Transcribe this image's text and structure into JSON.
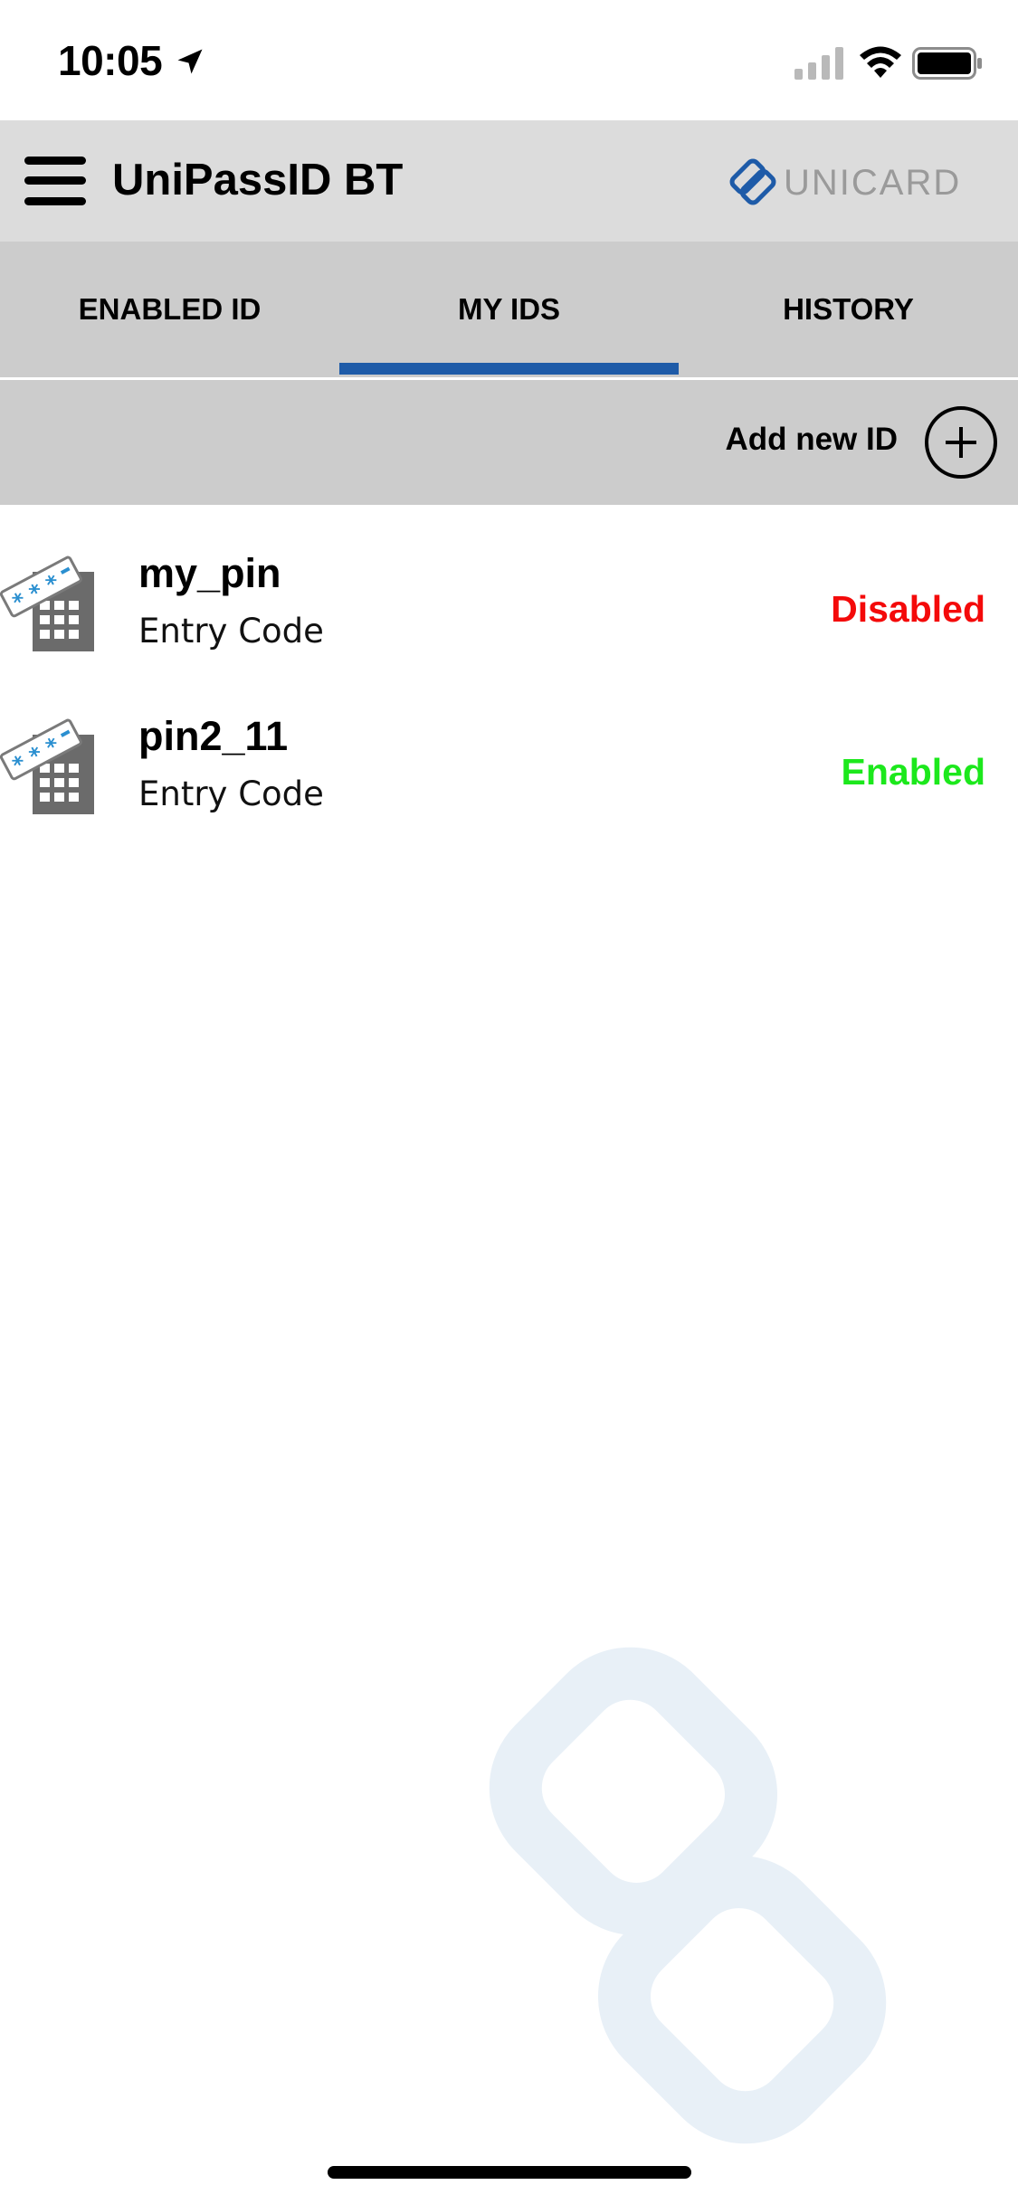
{
  "status_bar": {
    "time": "10:05",
    "location_icon": "location-arrow-icon",
    "signal_icon": "cellular-signal-icon",
    "wifi_icon": "wifi-icon",
    "battery_icon": "battery-icon"
  },
  "header": {
    "menu_icon": "hamburger-menu-icon",
    "title": "UniPassID BT",
    "brand_name": "UNICARD",
    "brand_color": "#1e5ba8"
  },
  "tabs": [
    {
      "label": "ENABLED ID",
      "active": false
    },
    {
      "label": "MY IDS",
      "active": true
    },
    {
      "label": "HISTORY",
      "active": false
    }
  ],
  "action_bar": {
    "add_label": "Add new ID",
    "add_icon": "plus-circle-icon"
  },
  "ids": [
    {
      "name": "my_pin",
      "type": "Entry Code",
      "status": "Disabled",
      "status_color": "#f40a0a",
      "icon": "keypad-entry-code-icon"
    },
    {
      "name": "pin2_11",
      "type": "Entry Code",
      "status": "Enabled",
      "status_color": "#1ce81c",
      "icon": "keypad-entry-code-icon"
    }
  ],
  "colors": {
    "header_bg": "#dcdcdc",
    "tab_bg": "#cccccc",
    "tab_indicator": "#1e5ba8",
    "watermark": "#e8f0f7"
  }
}
